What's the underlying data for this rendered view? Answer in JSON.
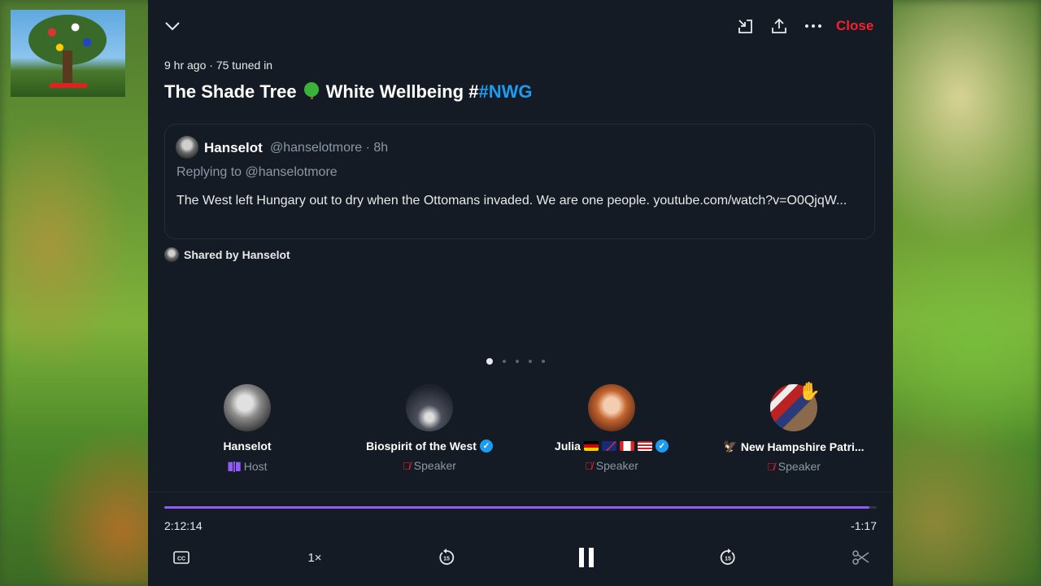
{
  "background": {
    "thumbnail_label": "tree-of-flags-thumbnail"
  },
  "header": {
    "close_label": "Close"
  },
  "space": {
    "meta": "9 hr ago · 75 tuned in",
    "title_prefix": "The Shade Tree",
    "title_middle": "White Wellbeing #",
    "title_hashtag": "#NWG"
  },
  "post": {
    "author": "Hanselot",
    "handle": "@hanselotmore · 8h",
    "replying": "Replying to @hanselotmore",
    "body": "The West left Hungary out to dry when the Ottomans invaded. We are one people. youtube.com/watch?v=O0QjqW..."
  },
  "shared_by": "Shared by Hanselot",
  "pager": {
    "pages": 5,
    "active": 0
  },
  "speakers": [
    {
      "name": "Hanselot",
      "role": "Host",
      "verified": false
    },
    {
      "name": "Biospirit of the West",
      "role": "Speaker",
      "verified": true
    },
    {
      "name": "Julia",
      "role": "Speaker",
      "verified": true
    },
    {
      "name": "New Hampshire Patri...",
      "role": "Speaker",
      "verified": false
    }
  ],
  "player": {
    "elapsed": "2:12:14",
    "remaining": "-1:17",
    "progress_fraction": 0.99,
    "speed": "1×"
  },
  "colors": {
    "accent": "#1d9bf0",
    "close": "#f4212e",
    "progress": "#8f5cf7",
    "panel": "#151b24"
  }
}
